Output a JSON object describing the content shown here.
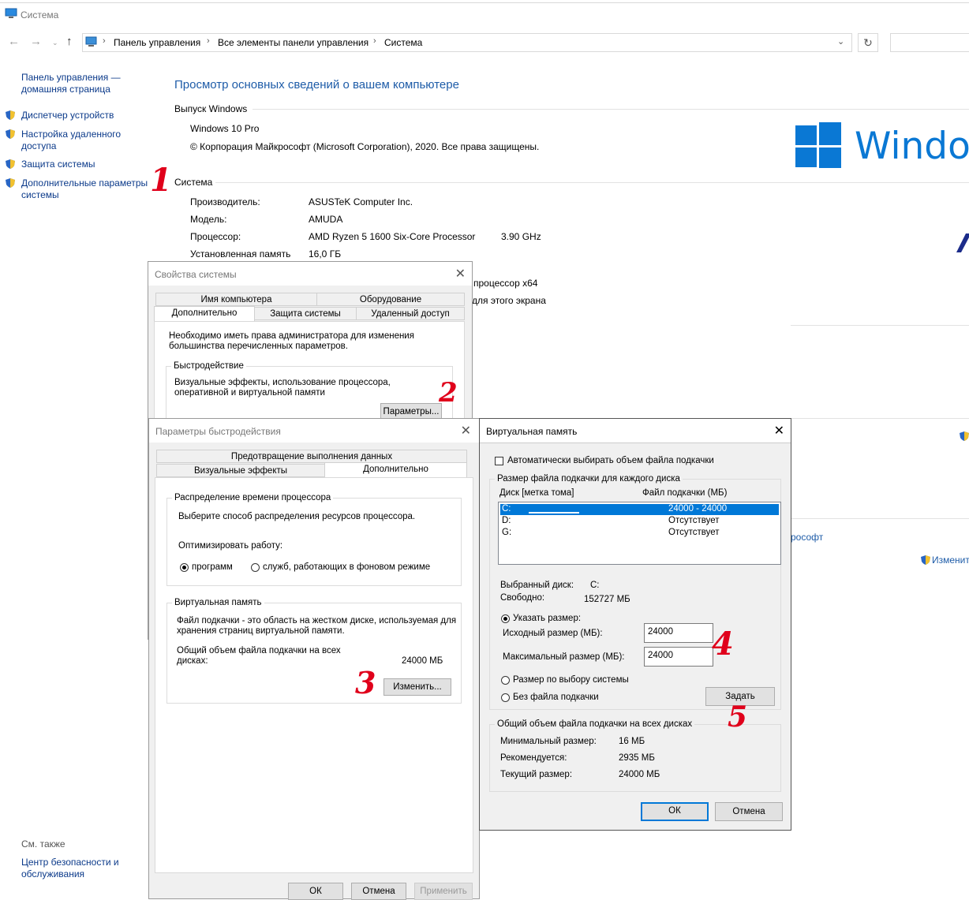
{
  "window": {
    "title": "Система"
  },
  "address": {
    "crumbs": [
      "Панель управления",
      "Все элементы панели управления",
      "Система"
    ],
    "refresh_icon": "↻"
  },
  "sidebar": {
    "home": "Панель управления — домашняя страница",
    "items": [
      "Диспетчер устройств",
      "Настройка удаленного доступа",
      "Защита системы",
      "Дополнительные параметры системы"
    ],
    "see_also_title": "См. также",
    "see_also_items": [
      "Центр безопасности и обслуживания"
    ]
  },
  "main": {
    "title": "Просмотр основных сведений о вашем компьютере",
    "edition_header": "Выпуск Windows",
    "edition": "Windows 10 Pro",
    "copyright": "© Корпорация Майкрософт (Microsoft Corporation), 2020. Все права защищены.",
    "brand_text": "Window",
    "system_header": "Система",
    "rows": [
      {
        "label": "Производитель:",
        "value": "ASUSTeK Computer Inc."
      },
      {
        "label": "Модель:",
        "value": "AMUDA"
      },
      {
        "label": "Процессор:",
        "value": "AMD Ryzen 5 1600 Six-Core Processor",
        "extra": "3.90 GHz"
      },
      {
        "label": "Установленная память",
        "value": "16,0 ГБ"
      }
    ],
    "partial_lines": [
      "процессор x64",
      "для этого экрана"
    ],
    "partial_link": "рософт",
    "change_link": "Изменить"
  },
  "sysprops": {
    "title": "Свойства системы",
    "tabs_top": [
      "Имя компьютера",
      "Оборудование"
    ],
    "tabs_bottom": [
      "Дополнительно",
      "Защита системы",
      "Удаленный доступ"
    ],
    "admin_note": "Необходимо иметь права администратора для изменения большинства перечисленных параметров.",
    "perf_legend": "Быстродействие",
    "perf_desc": "Визуальные эффекты, использование процессора, оперативной и виртуальной памяти",
    "params_button": "Параметры..."
  },
  "perf": {
    "title": "Параметры быстродействия",
    "tabs_top": [
      "Предотвращение выполнения данных"
    ],
    "tabs_bottom": [
      "Визуальные эффекты",
      "Дополнительно"
    ],
    "cpu_legend": "Распределение времени процессора",
    "cpu_desc": "Выберите способ распределения ресурсов процессора.",
    "optimize_label": "Оптимизировать работу:",
    "radio_programs": "программ",
    "radio_services": "служб, работающих в фоновом режиме",
    "vm_legend": "Виртуальная память",
    "vm_desc": "Файл подкачки - это область на жестком диске, используемая для хранения страниц виртуальной памяти.",
    "total_label": "Общий объем файла подкачки на всех дисках:",
    "total_value": "24000 МБ",
    "change_button": "Изменить...",
    "ok": "ОК",
    "cancel": "Отмена",
    "apply": "Применить"
  },
  "vm": {
    "title": "Виртуальная память",
    "auto_label": "Автоматически выбирать объем файла подкачки",
    "per_disk_legend": "Размер файла подкачки для каждого диска",
    "col_disk": "Диск [метка тома]",
    "col_size": "Файл подкачки (МБ)",
    "drives": [
      {
        "disk": "C:",
        "size": "24000 - 24000",
        "selected": true
      },
      {
        "disk": "D:",
        "size": "Отсутствует",
        "selected": false
      },
      {
        "disk": "G:",
        "size": "Отсутствует",
        "selected": false
      }
    ],
    "selected_label": "Выбранный диск:",
    "selected_value": "C:",
    "free_label": "Свободно:",
    "free_value": "152727 МБ",
    "custom_radio": "Указать размер:",
    "initial_label": "Исходный размер (МБ):",
    "initial_value": "24000",
    "max_label": "Максимальный размер (МБ):",
    "max_value": "24000",
    "system_radio": "Размер по выбору системы",
    "none_radio": "Без файла подкачки",
    "set_button": "Задать",
    "total_legend": "Общий объем файла подкачки на всех дисках",
    "min_label": "Минимальный размер:",
    "min_value": "16 МБ",
    "rec_label": "Рекомендуется:",
    "rec_value": "2935 МБ",
    "cur_label": "Текущий размер:",
    "cur_value": "24000 МБ",
    "ok": "ОК",
    "cancel": "Отмена"
  },
  "annotations": [
    "1",
    "2",
    "3",
    "4",
    "5"
  ],
  "colors": {
    "accent": "#0078d7",
    "link": "#0b3a8a",
    "title_blue": "#1e5ca8",
    "annotation": "#e0001b"
  }
}
